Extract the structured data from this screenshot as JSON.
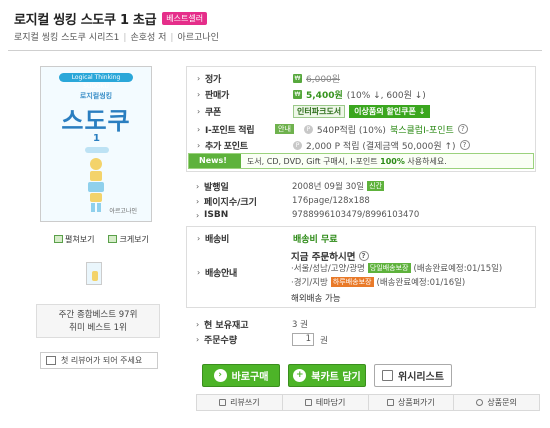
{
  "header": {
    "title": "로지컬 씽킹 스도쿠 1 초급",
    "badge": "베스트셀러",
    "meta_series": "로지컬 씽킹 스도쿠 시리즈1",
    "meta_author": "손호성 저",
    "meta_publisher": "아르고나인",
    "separator": "|"
  },
  "cover": {
    "strip": "Logical Thinking SUDOKU",
    "subtitle": "로지컬씽킹",
    "title": "스도쿠",
    "number": "1",
    "publisher": "아르고나인"
  },
  "left": {
    "preview_link": "펼쳐보기",
    "zoom_link": "크게보기",
    "rank_line1": "주간 종합베스트 97위",
    "rank_line2": "취미 베스트 1위",
    "review_button": "첫 리뷰어가 되어 주세요"
  },
  "price": {
    "list_label": "정가",
    "list_value": "6,000원",
    "sale_label": "판매가",
    "sale_value": "5,400원",
    "sale_detail": "(10% ↓, 600원 ↓)",
    "coupon_label": "쿠폰",
    "coupon_store": "인터파크도서",
    "coupon_button": "이상품의 할인쿠폰 ↓",
    "ipoint_label": "I-포인트 적립",
    "ipoint_tag": "안내",
    "ipoint_value": "540P적립 (10%)",
    "ipoint_link": "북스클럽I-포인트",
    "extra_label": "추가 포인트",
    "extra_value": "2,000 P 적립 (결제금액 50,000원 ↑)",
    "news_tag": "News!",
    "news_text": "도서, CD, DVD, Gift 구매시, I-포인트",
    "news_percent": "100%",
    "news_suffix": "사용하세요."
  },
  "info": {
    "pubdate_label": "발행일",
    "pubdate_value": "2008년 09월 30일",
    "pubdate_tag": "신간",
    "pages_label": "페이지수/크기",
    "pages_value": "176page/128x188",
    "isbn_label": "ISBN",
    "isbn_value": "9788996103479/8996103470"
  },
  "shipping": {
    "fee_label": "배송비",
    "fee_value": "배송비 무료",
    "guide_label": "배송안내",
    "order_now": "지금 주문하시면",
    "region1": "·서울/성남/고양/광명",
    "region1_tag": "당일배송보장",
    "region1_eta": "(배송완료예정:01/15일)",
    "region2": "·경기/지방",
    "region2_tag": "하루배송보장",
    "region2_eta": "(배송완료예정:01/16일)",
    "overseas": "해외배송 가능"
  },
  "stock": {
    "stock_label": "현 보유재고",
    "stock_value": "3 권",
    "qty_label": "주문수량",
    "qty_value": "1",
    "qty_unit": "권"
  },
  "buttons": {
    "buy": "바로구매",
    "cart": "북카트 담기",
    "wish": "위시리스트"
  },
  "actions": [
    "리뷰쓰기",
    "테마담기",
    "상품퍼가기",
    "상품문의"
  ]
}
